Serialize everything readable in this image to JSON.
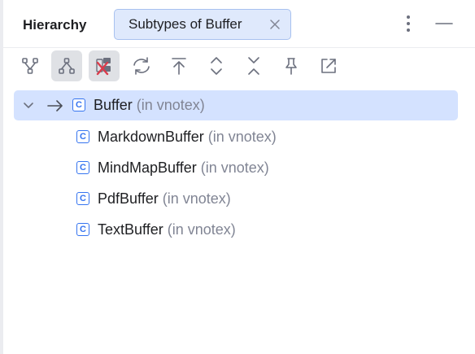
{
  "header": {
    "title": "Hierarchy",
    "tab_label": "Subtypes of Buffer",
    "icons": [
      "close-icon",
      "more-vertical-icon",
      "minimize-icon"
    ]
  },
  "toolbar": {
    "buttons": [
      {
        "icon": "supertypes-hierarchy-icon",
        "active": false
      },
      {
        "icon": "subtypes-hierarchy-icon",
        "active": true
      },
      {
        "icon": "class-hierarchy-icon",
        "active": true
      },
      {
        "icon": "refresh-icon",
        "active": false
      },
      {
        "icon": "base-on-this-class-icon",
        "active": false
      },
      {
        "icon": "expand-all-icon",
        "active": false
      },
      {
        "icon": "collapse-all-icon",
        "active": false
      },
      {
        "icon": "pin-icon",
        "active": false
      },
      {
        "icon": "open-in-window-icon",
        "active": false
      }
    ]
  },
  "tree": {
    "root": {
      "name": "Buffer",
      "package": "(in vnotex)",
      "icon": "C"
    },
    "children": [
      {
        "name": "MarkdownBuffer",
        "package": "(in vnotex)",
        "icon": "C"
      },
      {
        "name": "MindMapBuffer",
        "package": "(in vnotex)",
        "icon": "C"
      },
      {
        "name": "PdfBuffer",
        "package": "(in vnotex)",
        "icon": "C"
      },
      {
        "name": "TextBuffer",
        "package": "(in vnotex)",
        "icon": "C"
      }
    ]
  },
  "colors": {
    "selection": "#d4e2ff",
    "tab_bg": "#dfe9fc",
    "tab_border": "#a8c1ef",
    "accent": "#3574f0",
    "muted_text": "#818594",
    "error_red": "#db3b4b"
  }
}
